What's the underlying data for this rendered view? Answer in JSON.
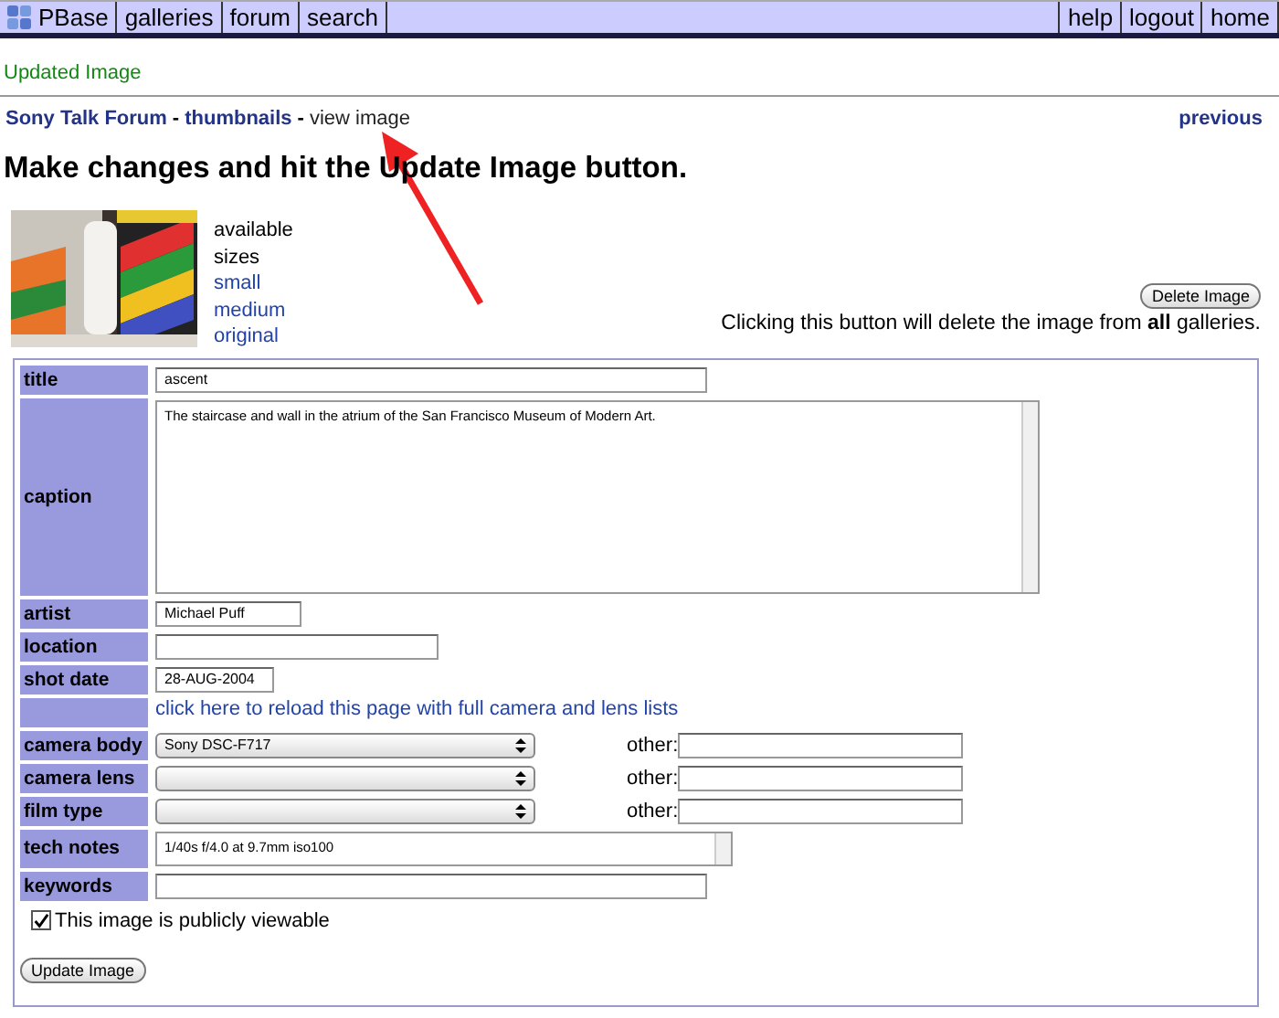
{
  "nav": {
    "left": [
      "PBase",
      "galleries",
      "forum",
      "search"
    ],
    "right": [
      "help",
      "logout",
      "home"
    ]
  },
  "status": "Updated Image",
  "breadcrumbs": [
    {
      "label": "Sony Talk Forum",
      "kind": "link"
    },
    {
      "label": "-",
      "kind": "sep"
    },
    {
      "label": "thumbnails",
      "kind": "link"
    },
    {
      "label": "-",
      "kind": "sep"
    },
    {
      "label": "view image",
      "kind": "current"
    }
  ],
  "previous": "previous",
  "heading": "Make changes and hit the Update Image button.",
  "sizes": {
    "title": "available sizes",
    "links": [
      "small",
      "medium",
      "original"
    ]
  },
  "delete": {
    "button": "Delete Image",
    "note": "Clicking this button will delete the image from **all** galleries."
  },
  "fields": [
    {
      "kind": "text",
      "label": "title",
      "value": "ascent"
    },
    {
      "kind": "textarea",
      "label": "caption",
      "value": "The staircase and wall in the atrium of the San Francisco Museum of Modern Art."
    },
    {
      "kind": "text",
      "label": "artist",
      "value": "Michael Puff"
    },
    {
      "kind": "text",
      "label": "location"
    },
    {
      "kind": "text",
      "label": "shot date",
      "value": "28-AUG-2004"
    },
    {
      "kind": "link",
      "text": "click here to reload this page with full camera and lens lists"
    },
    {
      "kind": "select",
      "label": "camera body",
      "value": "Sony DSC-F717",
      "other": "other:"
    },
    {
      "kind": "select",
      "label": "camera lens",
      "other": "other:"
    },
    {
      "kind": "select",
      "label": "film type",
      "other": "other:"
    },
    {
      "kind": "notes",
      "label": "tech notes",
      "value": "1/40s f/4.0 at 9.7mm iso100"
    },
    {
      "kind": "text",
      "label": "keywords"
    }
  ],
  "public": {
    "label": "This image is publicly viewable",
    "checked": true
  },
  "submit": "Update Image"
}
